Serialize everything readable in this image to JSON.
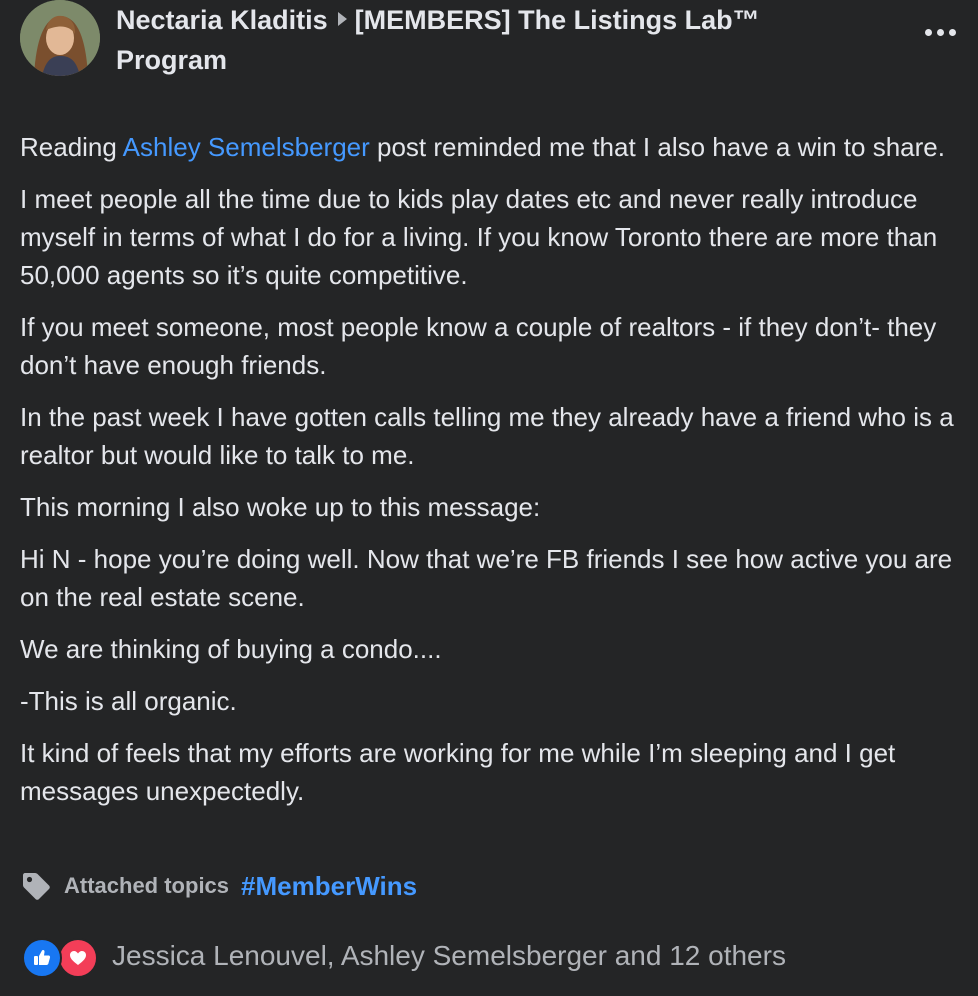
{
  "post": {
    "author": "Nectaria Kladitis",
    "group": "[MEMBERS] The Listings Lab™ Program",
    "paragraphs": {
      "p1": {
        "before": "Reading ",
        "mention": "Ashley Semelsberger",
        "after": " post reminded me that I also have a win to share."
      },
      "p2": "I meet people all the time due to kids play dates etc and never really introduce myself in terms of what I do for a living. If you know Toronto there are more than 50,000 agents so it’s quite competitive.",
      "p3": "If you meet someone, most people know a couple of realtors - if they don’t- they don’t have enough friends.",
      "p4": "In the past week I have gotten calls telling me they already have a friend who is a realtor but would like to talk to me.",
      "p5": "This morning I also woke up to this message:",
      "p6": "Hi N - hope you’re doing well. Now that we’re FB friends I see how active you are on the real estate scene.",
      "p7": "We are thinking of buying a condo....",
      "p8": "-This is all organic.",
      "p9": "It kind of feels that my efforts are working for me while I’m sleeping and I get messages unexpectedly."
    },
    "topics": {
      "label": "Attached topics",
      "tag": "#MemberWins"
    },
    "reactions": {
      "names": "Jessica Lenouvel, Ashley Semelsberger and 12 others",
      "types": [
        "like",
        "love"
      ]
    }
  },
  "colors": {
    "background": "#242526",
    "text": "#e4e6eb",
    "secondary_text": "#b0b3b8",
    "link": "#4599ff",
    "like": "#1877f2",
    "love": "#f33e58"
  },
  "icons": {
    "menu": "more-horizontal-icon",
    "separator": "caret-right-icon",
    "topics": "tag-icon",
    "like": "thumbs-up-icon",
    "love": "heart-icon"
  }
}
